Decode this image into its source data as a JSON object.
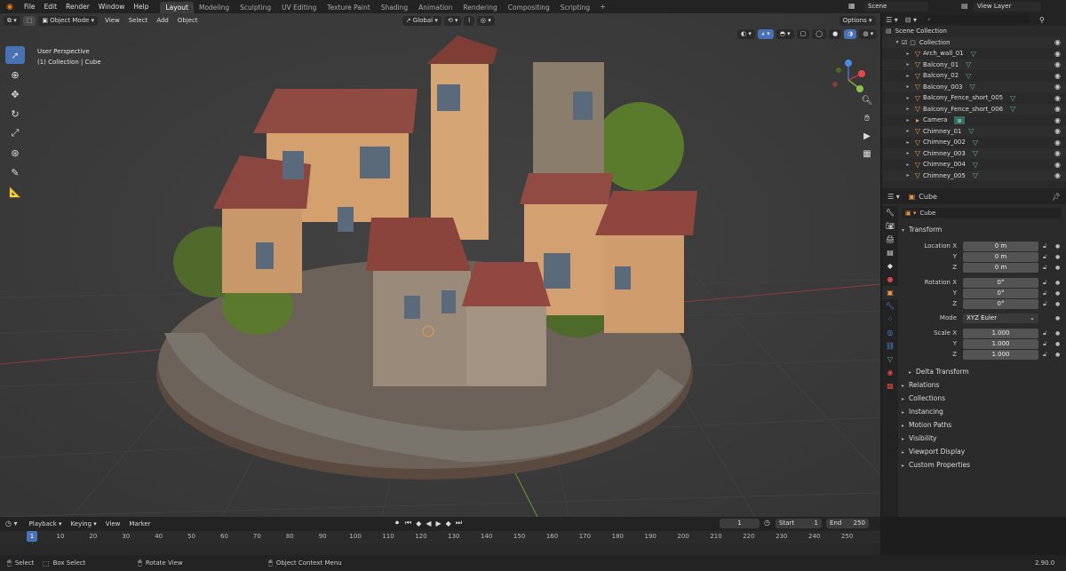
{
  "menu": [
    "File",
    "Edit",
    "Render",
    "Window",
    "Help"
  ],
  "workspaces": [
    "Layout",
    "Modeling",
    "Sculpting",
    "UV Editing",
    "Texture Paint",
    "Shading",
    "Animation",
    "Rendering",
    "Compositing",
    "Scripting"
  ],
  "active_workspace": "Layout",
  "scene_name": "Scene",
  "view_layer": "View Layer",
  "viewport": {
    "mode": "Object Mode",
    "menus": [
      "View",
      "Select",
      "Add",
      "Object"
    ],
    "transform_orientation": "Global",
    "options_label": "Options",
    "info_line1": "User Perspective",
    "info_line2": "(1) Collection | Cube"
  },
  "outliner": {
    "root": "Scene Collection",
    "collection": "Collection",
    "items": [
      "Arch_wall_01",
      "Balcony_01",
      "Balcony_02",
      "Balcony_003",
      "Balcony_Fence_short_005",
      "Balcony_Fence_short_006",
      "Camera",
      "Chimney_01",
      "Chimney_002",
      "Chimney_003",
      "Chimney_004",
      "Chimney_005"
    ]
  },
  "properties": {
    "object_name": "Cube",
    "object_field": "Cube",
    "transform_title": "Transform",
    "location_label": "Location X",
    "location": [
      "0 m",
      "0 m",
      "0 m"
    ],
    "rotation_label": "Rotation X",
    "rotation": [
      "0°",
      "0°",
      "0°"
    ],
    "mode_label": "Mode",
    "mode_value": "XYZ Euler",
    "scale_label": "Scale X",
    "scale": [
      "1.000",
      "1.000",
      "1.000"
    ],
    "axis_y": "Y",
    "axis_z": "Z",
    "delta_transform": "Delta Transform",
    "sections": [
      "Relations",
      "Collections",
      "Instancing",
      "Motion Paths",
      "Visibility",
      "Viewport Display",
      "Custom Properties"
    ]
  },
  "timeline": {
    "menus": [
      "Playback",
      "Keying",
      "View",
      "Marker"
    ],
    "current_frame": "1",
    "start_label": "Start",
    "start": "1",
    "end_label": "End",
    "end": "250",
    "ticks": [
      "10",
      "20",
      "30",
      "40",
      "50",
      "60",
      "70",
      "80",
      "90",
      "100",
      "110",
      "120",
      "130",
      "140",
      "150",
      "160",
      "170",
      "180",
      "190",
      "200",
      "210",
      "220",
      "230",
      "240",
      "250"
    ],
    "playhead": "1"
  },
  "statusbar": {
    "select": "Select",
    "box_select": "Box Select",
    "rotate_view": "Rotate View",
    "context_menu": "Object Context Menu",
    "version": "2.90.0"
  },
  "colors": {
    "accent": "#4772b3",
    "orange": "#e87d0d",
    "mesh": "#5ab9a5"
  }
}
